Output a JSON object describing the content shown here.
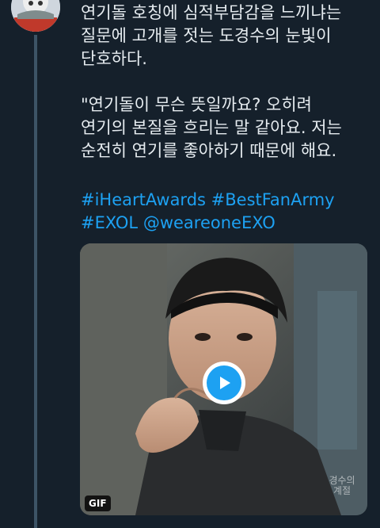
{
  "tweet": {
    "paragraph1": [
      "연기돌 호칭에 심적부담감을 느끼냐는",
      "질문에 고개를 젓는 도경수의 눈빛이",
      "단호하다."
    ],
    "paragraph2": [
      "\"연기돌이 무슨 뜻일까요? 오히려",
      "연기의 본질을 흐리는 말 같아요. 저는",
      "순전히 연기를 좋아하기 때문에 해요."
    ],
    "hashtag_iheartawards": "#iHeartAwards",
    "hashtag_bestfanarmy": "#BestFanArmy",
    "hashtag_exol": "#EXOL",
    "mention": "@weareoneEXO"
  },
  "media": {
    "type_badge": "GIF",
    "watermark": "경수의 계절",
    "play_icon": "play-icon"
  },
  "colors": {
    "background": "#15202b",
    "text": "#e6ecf0",
    "link": "#1da1f2",
    "thread_line": "#3d5466"
  }
}
